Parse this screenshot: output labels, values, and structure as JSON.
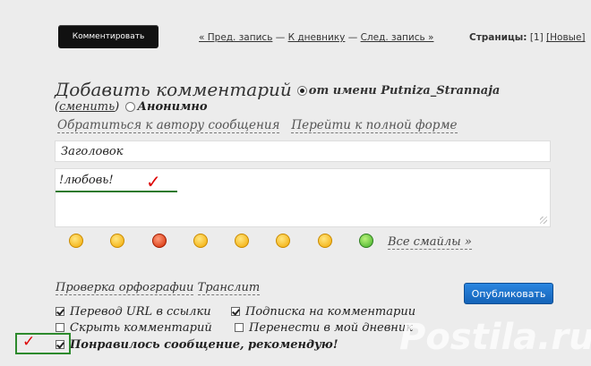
{
  "topbar": {
    "comment_button": "Комментировать",
    "prev_link": "« Пред. запись",
    "sep1": " — ",
    "diary_link": "К дневнику",
    "sep2": " — ",
    "next_link": "След. запись »",
    "pages_label": "Страницы:",
    "page_current": "[1]",
    "page_new": "[Новые]"
  },
  "form": {
    "heading": "Добавить комментарий",
    "from_name": "от имени Putniza_Strannaja",
    "change_open": "(",
    "change_link": "сменить",
    "change_close": ")",
    "anonymous": "Анонимно",
    "contact_author": "Обратиться к автору сообщения",
    "full_form": "Перейти к полной форме",
    "title_value": "Заголовок",
    "body_value": "!любовь!",
    "check_glyph": "✓"
  },
  "smileys": {
    "all_label": "Все смайлы »",
    "items": [
      "smile-1",
      "smile-2",
      "smile-3",
      "smile-4",
      "smile-5",
      "smile-6",
      "smile-7",
      "smile-8"
    ]
  },
  "tools": {
    "spell": "Проверка орфографии",
    "translit": "Транслит",
    "publish": "Опубликовать"
  },
  "options": {
    "url_to_links": "Перевод URL в ссылки",
    "subscribe": "Подписка на комментарии",
    "hide_comment": "Скрыть комментарий",
    "move_to_diary": "Перенести в мой дневник",
    "recommend": "Понравилось сообщение, рекомендую!"
  },
  "watermark": {
    "text": "Postila.ru"
  },
  "colors": {
    "accent_blue": "#1a6fcc",
    "annotation_green": "#2d8a2d",
    "annotation_red": "#dd0000"
  }
}
